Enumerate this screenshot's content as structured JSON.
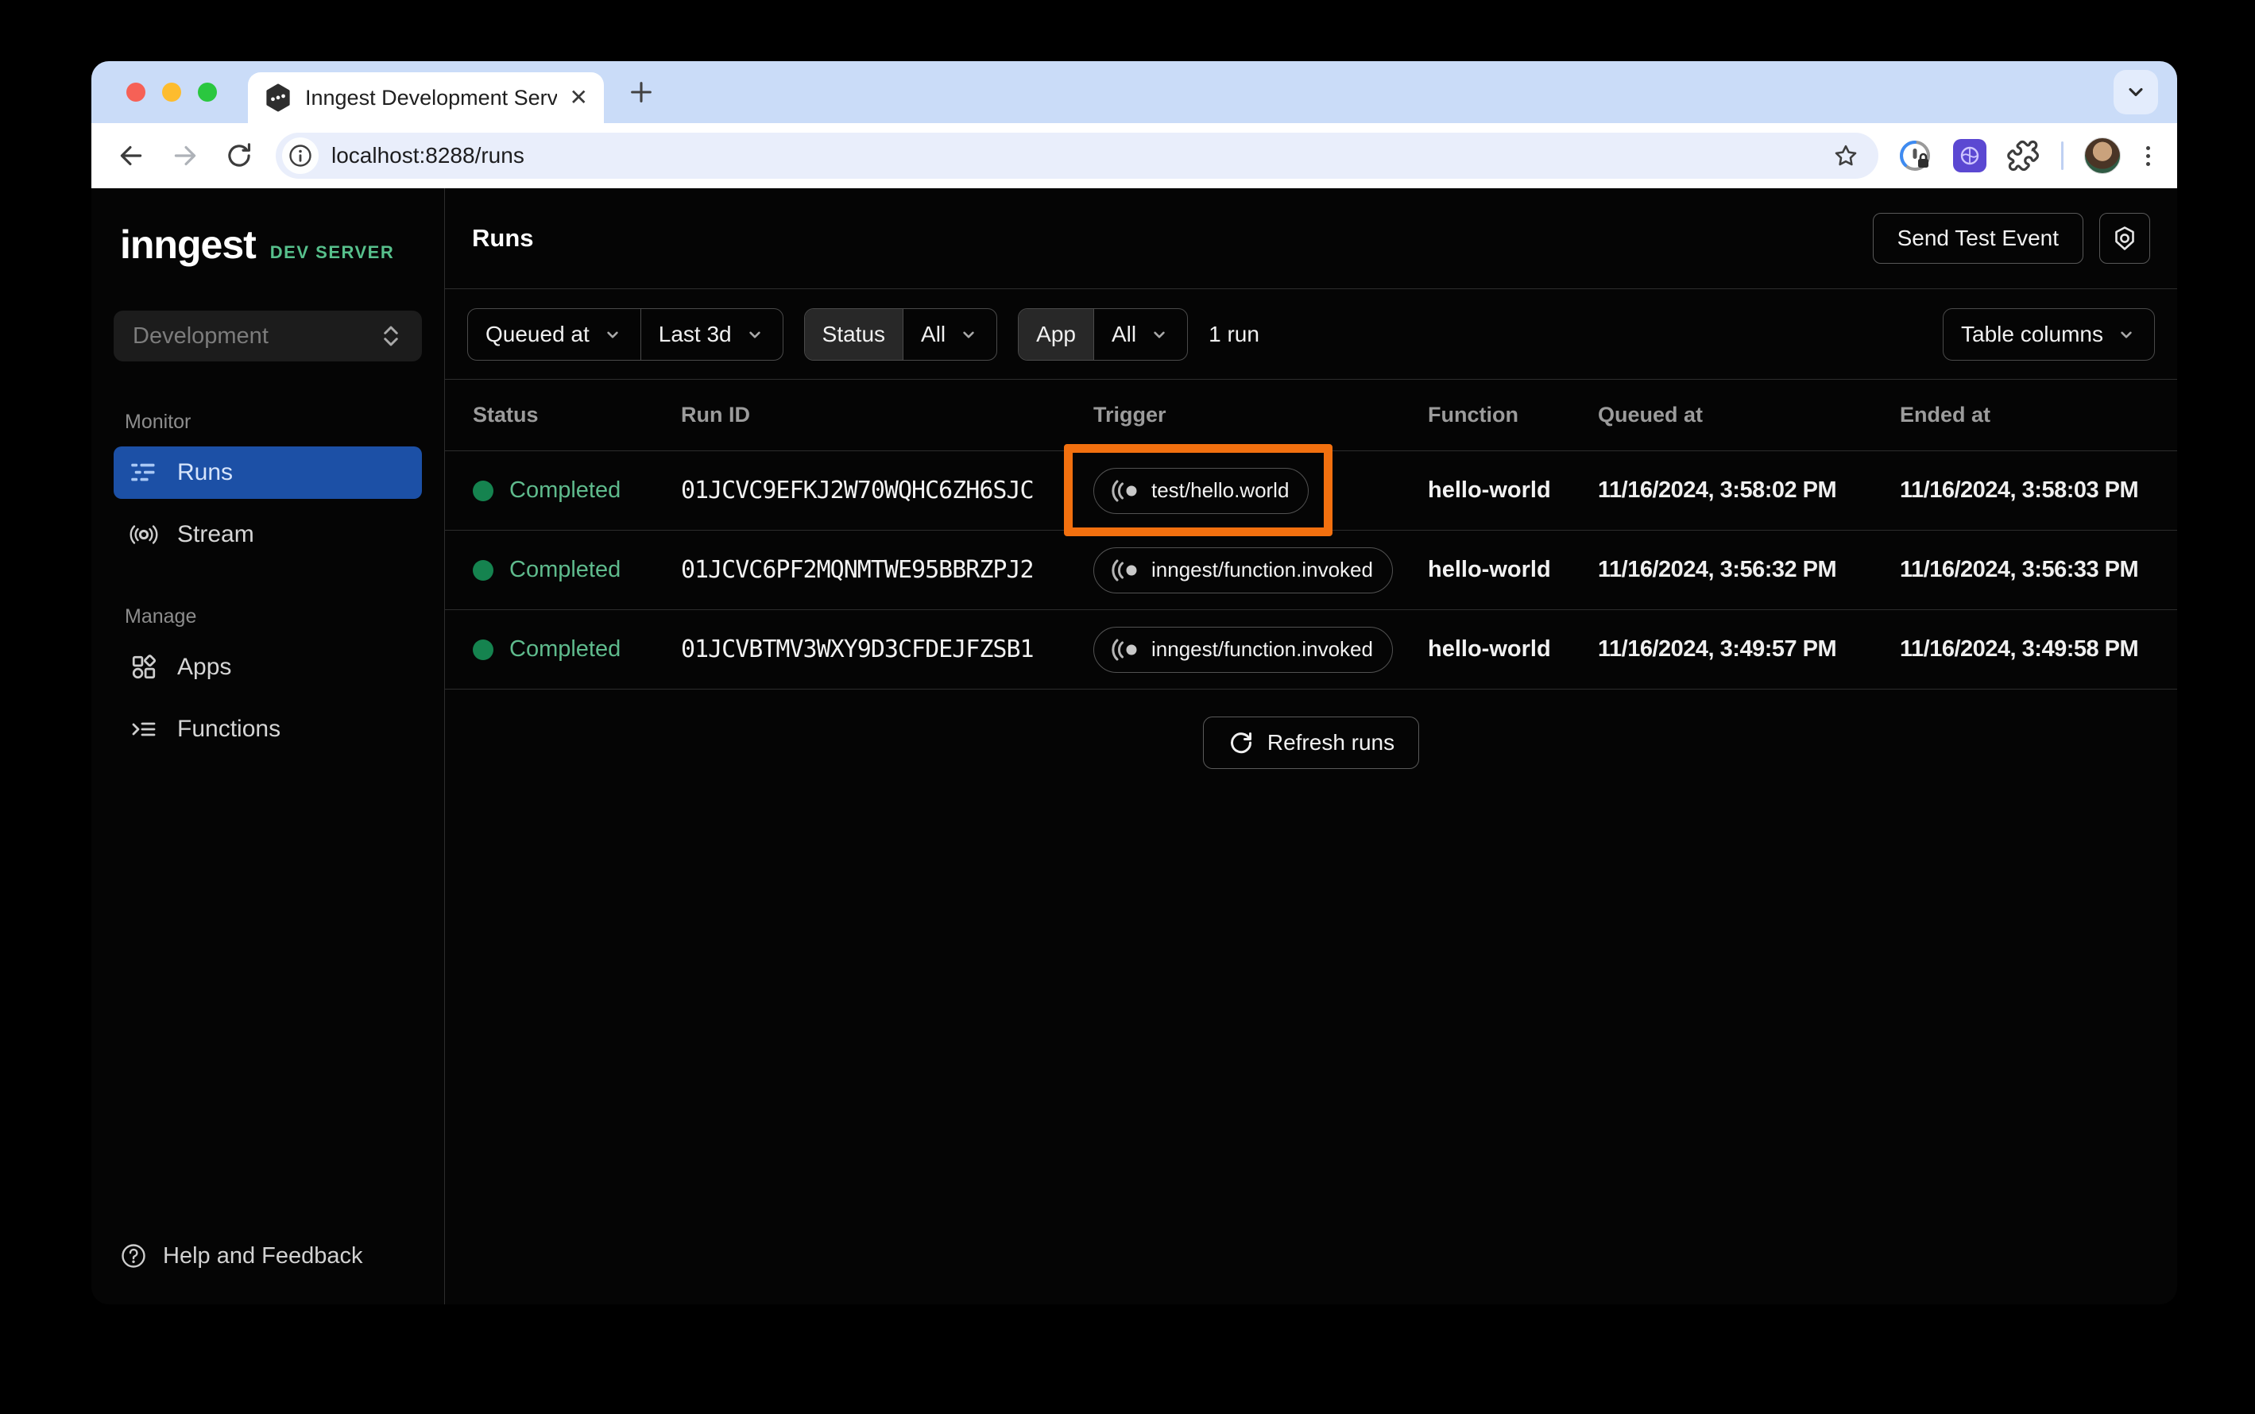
{
  "browser": {
    "tab_title": "Inngest Development Server",
    "url": "localhost:8288/runs"
  },
  "sidebar": {
    "logo": "inngest",
    "logo_badge": "DEV SERVER",
    "env_select": "Development",
    "section_monitor": "Monitor",
    "section_manage": "Manage",
    "item_runs": "Runs",
    "item_stream": "Stream",
    "item_apps": "Apps",
    "item_functions": "Functions",
    "help": "Help and Feedback"
  },
  "header": {
    "title": "Runs",
    "send_test_event": "Send Test Event"
  },
  "filters": {
    "queued_at_label": "Queued at",
    "range_value": "Last 3d",
    "status_label": "Status",
    "status_value": "All",
    "app_label": "App",
    "app_value": "All",
    "run_count": "1 run",
    "table_columns": "Table columns"
  },
  "table": {
    "headers": {
      "status": "Status",
      "run_id": "Run ID",
      "trigger": "Trigger",
      "function": "Function",
      "queued_at": "Queued at",
      "ended_at": "Ended at"
    },
    "rows": [
      {
        "status": "Completed",
        "run_id": "01JCVC9EFKJ2W70WQHC6ZH6SJC",
        "trigger": "test/hello.world",
        "function": "hello-world",
        "queued_at": "11/16/2024, 3:58:02 PM",
        "ended_at": "11/16/2024, 3:58:03 PM"
      },
      {
        "status": "Completed",
        "run_id": "01JCVC6PF2MQNMTWE95BBRZPJ2",
        "trigger": "inngest/function.invoked",
        "function": "hello-world",
        "queued_at": "11/16/2024, 3:56:32 PM",
        "ended_at": "11/16/2024, 3:56:33 PM"
      },
      {
        "status": "Completed",
        "run_id": "01JCVBTMV3WXY9D3CFDEJFZSB1",
        "trigger": "inngest/function.invoked",
        "function": "hello-world",
        "queued_at": "11/16/2024, 3:49:57 PM",
        "ended_at": "11/16/2024, 3:49:58 PM"
      }
    ],
    "refresh": "Refresh runs"
  },
  "colors": {
    "selected_nav_blue": "#1c50a6",
    "success_green_text": "#5fbb8d",
    "success_green_dot": "#15834f",
    "dev_server_green": "#57c08c",
    "annotation_orange": "#f2700f",
    "tabstrip_blue": "#cadcf8",
    "app_background": "#050505"
  }
}
